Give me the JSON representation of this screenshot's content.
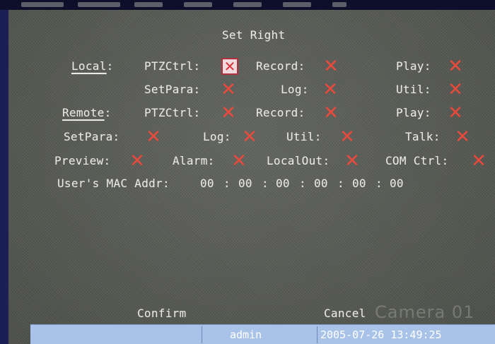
{
  "dialog": {
    "title": "Set Right"
  },
  "local": {
    "label": "Local",
    "colon": ":",
    "ptz_label": "PTZCtrl:",
    "record_label": "Record:",
    "play_label": "Play:",
    "setpara_label": "SetPara:",
    "log_label": "Log:",
    "util_label": "Util:"
  },
  "remote": {
    "label": "Remote",
    "colon": ":",
    "ptz_label": "PTZCtrl:",
    "record_label": "Record:",
    "play_label": "Play:",
    "setpara_label": "SetPara:",
    "log_label": "Log:",
    "util_label": "Util:",
    "talk_label": "Talk:",
    "preview_label": "Preview:",
    "alarm_label": "Alarm:",
    "localout_label": "LocalOut:",
    "comctrl_label": "COM Ctrl:"
  },
  "mac": {
    "label": "User's MAC Addr:",
    "octets": [
      "00",
      "00",
      "00",
      "00",
      "00",
      "00"
    ],
    "separator": ":"
  },
  "checkbox_mark": "✕",
  "buttons": {
    "confirm": "Confirm",
    "cancel": "Cancel"
  },
  "watermark": "Camera 01",
  "status": {
    "user": "admin",
    "datetime": "2005-07-26 13:49:25"
  },
  "colors": {
    "check_red": "#e84a3c",
    "status_bar": "#a9c3e8",
    "background": "#585a55"
  }
}
